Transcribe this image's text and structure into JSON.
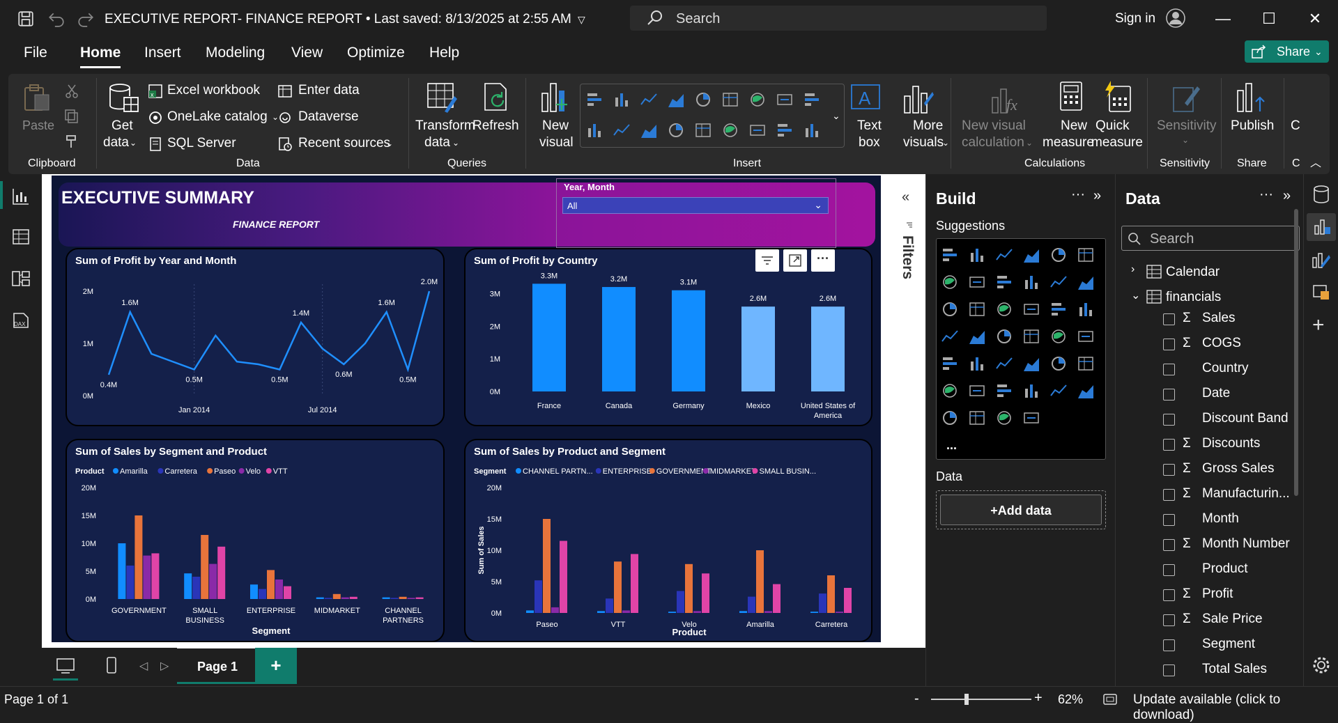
{
  "titlebar": {
    "document_title": "EXECUTIVE REPORT- FINANCE REPORT",
    "saved_status": "Last saved: 8/13/2025 at 2:55 AM",
    "search_label": "Search",
    "sign_in": "Sign in"
  },
  "menu": {
    "items": [
      "File",
      "Home",
      "Insert",
      "Modeling",
      "View",
      "Optimize",
      "Help"
    ],
    "active": "Home",
    "share_label": "Share"
  },
  "ribbon": {
    "clipboard": {
      "paste": "Paste",
      "group": "Clipboard"
    },
    "data": {
      "get_data_line1": "Get",
      "get_data_line2": "data",
      "excel": "Excel workbook",
      "onelake": "OneLake catalog",
      "sql": "SQL Server",
      "enter_data": "Enter data",
      "dataverse": "Dataverse",
      "recent": "Recent sources",
      "group": "Data"
    },
    "queries": {
      "transform_line1": "Transform",
      "transform_line2": "data",
      "refresh": "Refresh",
      "group": "Queries"
    },
    "insert": {
      "new_visual_line1": "New",
      "new_visual_line2": "visual",
      "text_box_line1": "Text",
      "text_box_line2": "box",
      "more_visuals_line1": "More",
      "more_visuals_line2": "visuals",
      "group": "Insert"
    },
    "calculations": {
      "new_visual_calc_line1": "New visual",
      "new_visual_calc_line2": "calculation",
      "new_measure_line1": "New",
      "new_measure_line2": "measure",
      "quick_measure_line1": "Quick",
      "quick_measure_line2": "measure",
      "group": "Calculations"
    },
    "sensitivity": {
      "label": "Sensitivity",
      "group": "Sensitivity"
    },
    "share": {
      "publish": "Publish",
      "group": "Share",
      "clipped_c": "C",
      "clipped_group": "C"
    }
  },
  "report": {
    "title": "EXECUTIVE SUMMARY",
    "subtitle": "FINANCE REPORT",
    "slicer_label": "Year, Month",
    "slicer_value": "All"
  },
  "chart_data": [
    {
      "type": "line",
      "title": "Sum of Profit by Year and Month",
      "x_tick_labels": [
        "Jan 2014",
        "Jul 2014"
      ],
      "y_tick_labels": [
        "0M",
        "1M",
        "2M"
      ],
      "ylim": [
        0,
        2000000
      ],
      "values": [
        0.4,
        1.6,
        0.8,
        0.65,
        0.5,
        1.15,
        0.65,
        0.6,
        0.5,
        1.4,
        0.9,
        0.6,
        1.0,
        1.6,
        0.5,
        2.0
      ],
      "data_labels": [
        {
          "index": 0,
          "text": "0.4M"
        },
        {
          "index": 1,
          "text": "1.6M"
        },
        {
          "index": 4,
          "text": "0.5M"
        },
        {
          "index": 8,
          "text": "0.5M"
        },
        {
          "index": 9,
          "text": "1.4M"
        },
        {
          "index": 11,
          "text": "0.6M"
        },
        {
          "index": 13,
          "text": "1.6M"
        },
        {
          "index": 14,
          "text": "0.5M"
        },
        {
          "index": 15,
          "text": "2.0M"
        }
      ],
      "color": "#1f8fff"
    },
    {
      "type": "bar",
      "title": "Sum of Profit by Country",
      "categories": [
        "France",
        "Canada",
        "Germany",
        "Mexico",
        "United States of America"
      ],
      "values": [
        3.3,
        3.2,
        3.1,
        2.6,
        2.6
      ],
      "value_labels": [
        "3.3M",
        "3.2M",
        "3.1M",
        "2.6M",
        "2.6M"
      ],
      "y_tick_labels": [
        "0M",
        "1M",
        "2M",
        "3M"
      ],
      "ylim": [
        0,
        3.5
      ],
      "colors": [
        "#118dff",
        "#118dff",
        "#118dff",
        "#6fb6ff",
        "#6fb6ff"
      ]
    },
    {
      "type": "bar",
      "title": "Sum of Sales by Segment and Product",
      "legend_title": "Product",
      "xlabel": "Segment",
      "categories": [
        "GOVERNMENT",
        "SMALL BUSINESS",
        "ENTERPRISE",
        "MIDMARKET",
        "CHANNEL PARTNERS"
      ],
      "y_tick_labels": [
        "0M",
        "5M",
        "10M",
        "15M",
        "20M"
      ],
      "ylim": [
        0,
        20
      ],
      "series": [
        {
          "name": "Amarilla",
          "color": "#118dff",
          "values": [
            10.0,
            4.6,
            2.6,
            0.3,
            0.3
          ]
        },
        {
          "name": "Carretera",
          "color": "#2a35b8",
          "values": [
            6.0,
            4.0,
            1.8,
            0.2,
            0.2
          ]
        },
        {
          "name": "Paseo",
          "color": "#e8743b",
          "values": [
            15.0,
            11.5,
            5.2,
            0.9,
            0.4
          ]
        },
        {
          "name": "Velo",
          "color": "#8a2aa8",
          "values": [
            7.8,
            6.3,
            3.5,
            0.3,
            0.2
          ]
        },
        {
          "name": "VTT",
          "color": "#e044a7",
          "values": [
            8.2,
            9.4,
            2.3,
            0.4,
            0.3
          ]
        }
      ]
    },
    {
      "type": "bar",
      "title": "Sum of Sales by Product and Segment",
      "legend_title": "Segment",
      "xlabel": "Product",
      "ylabel": "Sum of Sales",
      "categories": [
        "Paseo",
        "VTT",
        "Velo",
        "Amarilla",
        "Carretera"
      ],
      "y_tick_labels": [
        "0M",
        "5M",
        "10M",
        "15M",
        "20M"
      ],
      "ylim": [
        0,
        20
      ],
      "series": [
        {
          "name": "CHANNEL PARTN...",
          "color": "#118dff",
          "values": [
            0.4,
            0.3,
            0.2,
            0.3,
            0.2
          ]
        },
        {
          "name": "ENTERPRISE",
          "color": "#2a35b8",
          "values": [
            5.2,
            2.3,
            3.5,
            2.6,
            3.1
          ]
        },
        {
          "name": "GOVERNMENT",
          "color": "#e8743b",
          "values": [
            15.0,
            8.2,
            7.8,
            10.0,
            6.0
          ]
        },
        {
          "name": "MIDMARKET",
          "color": "#8a2aa8",
          "values": [
            0.9,
            0.4,
            0.3,
            0.3,
            0.2
          ]
        },
        {
          "name": "SMALL BUSIN...",
          "color": "#e044a7",
          "values": [
            11.5,
            9.4,
            6.3,
            4.6,
            4.0
          ]
        }
      ]
    }
  ],
  "filters_label": "Filters",
  "build": {
    "title": "Build",
    "suggestions_label": "Suggestions",
    "more": "...",
    "data_label": "Data",
    "add_data": "+Add data"
  },
  "data_pane": {
    "title": "Data",
    "search_placeholder": "Search",
    "tables": [
      "Calendar",
      "financials"
    ],
    "fields": [
      {
        "name": "Sales",
        "sigma": true
      },
      {
        "name": "COGS",
        "sigma": true
      },
      {
        "name": "Country",
        "sigma": false
      },
      {
        "name": "Date",
        "sigma": false
      },
      {
        "name": "Discount Band",
        "sigma": false
      },
      {
        "name": "Discounts",
        "sigma": true
      },
      {
        "name": "Gross Sales",
        "sigma": true
      },
      {
        "name": "Manufacturin...",
        "sigma": true
      },
      {
        "name": "Month",
        "sigma": false
      },
      {
        "name": "Month Number",
        "sigma": true
      },
      {
        "name": "Product",
        "sigma": false
      },
      {
        "name": "Profit",
        "sigma": true
      },
      {
        "name": "Sale Price",
        "sigma": true
      },
      {
        "name": "Segment",
        "sigma": false
      },
      {
        "name": "Total Sales",
        "sigma": false
      }
    ],
    "sigma_glyph": "Σ"
  },
  "pages": {
    "tab": "Page 1",
    "add": "+"
  },
  "status": {
    "page_info": "Page 1 of 1",
    "zoom_minus": "-",
    "zoom_plus": "+",
    "zoom": "62%",
    "zoom_level": 0.62,
    "update": "Update available (click to download)"
  },
  "colors": {
    "accent": "#107c6c",
    "chart_blue": "#118dff",
    "header_pink": "#a3139f"
  }
}
